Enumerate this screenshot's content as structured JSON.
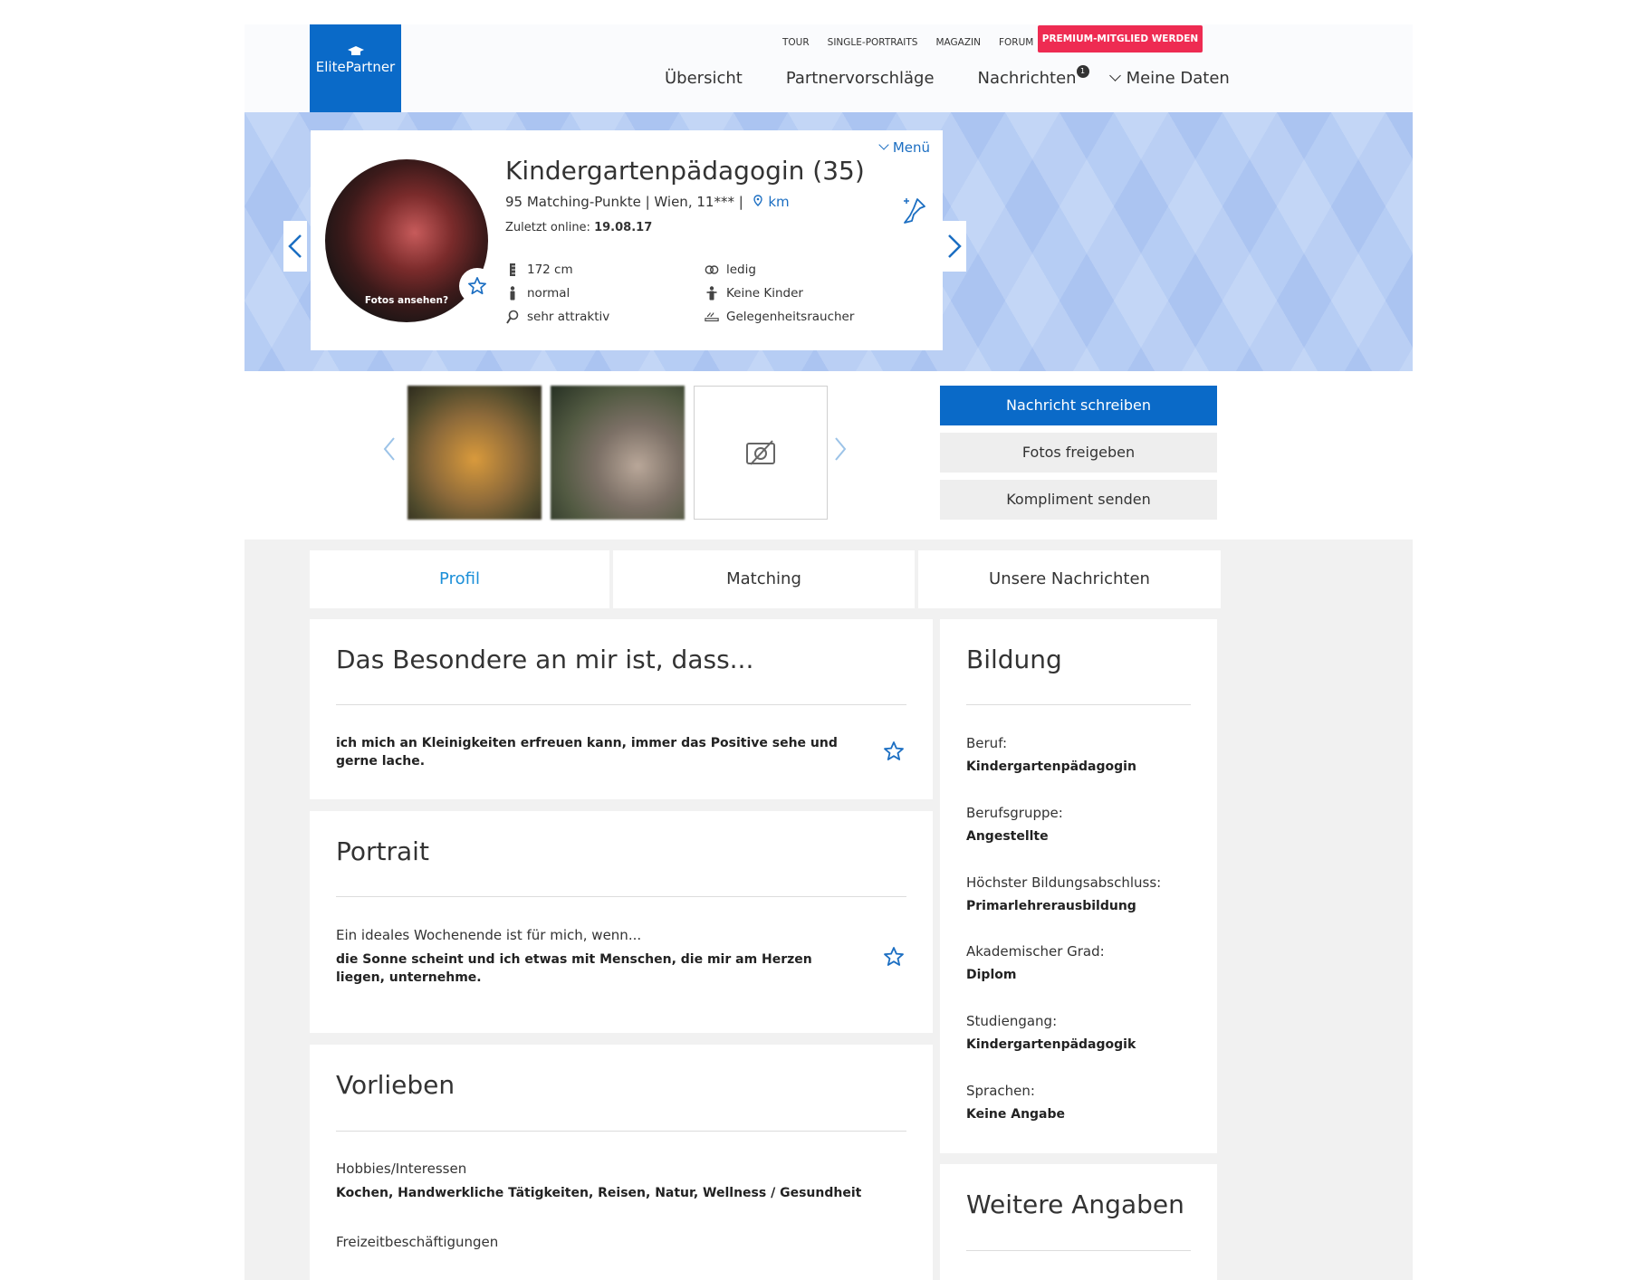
{
  "header": {
    "logo_text": "ElitePartner",
    "topnav": [
      "TOUR",
      "SINGLE-PORTRAITS",
      "MAGAZIN",
      "FORUM"
    ],
    "premium_button": "PREMIUM-MITGLIED WERDEN",
    "mainnav": {
      "overview": "Übersicht",
      "suggestions": "Partnervorschläge",
      "messages": "Nachrichten",
      "messages_badge": "1",
      "mydata": "Meine Daten"
    }
  },
  "profile": {
    "menu_label": "Menü",
    "name": "Kindergartenpädagogin (35)",
    "matching": "95 Matching-Punkte | Wien, 11*** |",
    "distance": "km",
    "online_label": "Zuletzt online:",
    "online_date": "19.08.17",
    "fotos_label": "Fotos ansehen?",
    "attributes": {
      "height": "172 cm",
      "status": "ledig",
      "figure": "normal",
      "children": "Keine Kinder",
      "attractiveness": "sehr attraktiv",
      "smoking": "Gelegenheitsraucher"
    }
  },
  "actions": {
    "write_message": "Nachricht schreiben",
    "share_photos": "Fotos freigeben",
    "send_compliment": "Kompliment senden"
  },
  "tabs": {
    "profile": "Profil",
    "matching": "Matching",
    "messages": "Unsere Nachrichten"
  },
  "special": {
    "title": "Das Besondere an mir ist, dass...",
    "text": "ich mich an Kleinigkeiten erfreuen kann, immer das Positive sehe und gerne lache."
  },
  "portrait": {
    "title": "Portrait",
    "question": "Ein ideales Wochenende ist für mich, wenn...",
    "answer": "die Sonne scheint und ich etwas mit Menschen, die mir am Herzen liegen, unternehme."
  },
  "preferences": {
    "title": "Vorlieben",
    "hobbies_label": "Hobbies/Interessen",
    "hobbies_value": "Kochen, Handwerkliche Tätigkeiten, Reisen, Natur, Wellness / Gesundheit",
    "leisure_label": "Freizeitbeschäftigungen"
  },
  "education": {
    "title": "Bildung",
    "items": [
      {
        "label": "Beruf:",
        "value": "Kindergartenpädagogin"
      },
      {
        "label": "Berufsgruppe:",
        "value": "Angestellte"
      },
      {
        "label": "Höchster Bildungsabschluss:",
        "value": "Primarlehrerausbildung"
      },
      {
        "label": "Akademischer Grad:",
        "value": "Diplom"
      },
      {
        "label": "Studiengang:",
        "value": "Kindergartenpädagogik"
      },
      {
        "label": "Sprachen:",
        "value": "Keine Angabe"
      }
    ]
  },
  "more": {
    "title": "Weitere Angaben"
  },
  "colors": {
    "brand_blue": "#0a6ac8",
    "premium_red": "#ee2b52",
    "link_blue": "#1b6ec2"
  }
}
